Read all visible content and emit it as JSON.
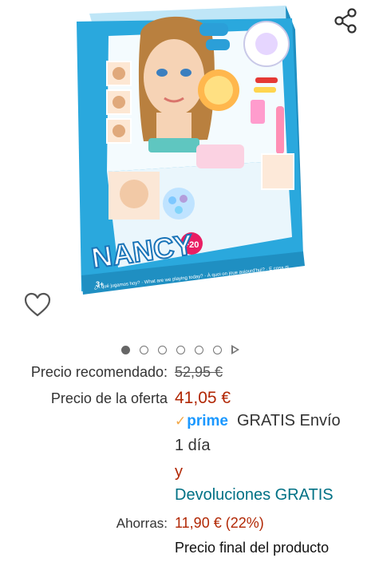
{
  "product": {
    "brand_on_box": "NANCY",
    "box_badge": "+20",
    "age_badge": "3+",
    "box_banner_text": "¿A qué jugamos hoy? · What are we playing today? · À quoi on joue aujourd'hui? · E cosa gi"
  },
  "actions": {
    "share_icon": "share-icon",
    "wishlist_icon": "heart-outline-icon"
  },
  "carousel": {
    "total_dots": 6,
    "active_index": 0,
    "has_video": true
  },
  "pricing": {
    "rrp_label": "Precio recomendado:",
    "rrp_value": "52,95 €",
    "offer_label": "Precio de la oferta",
    "offer_price": "41,05 €",
    "prime_label": "prime",
    "shipping_text": "GRATIS Envío",
    "delivery_days": "1 día",
    "and_text": "y",
    "returns_text": "Devoluciones GRATIS",
    "savings_label": "Ahorras:",
    "savings_value": "11,90 € (22%)",
    "final_price_note": "Precio final del producto"
  },
  "colors": {
    "price_red": "#B12704",
    "link_teal": "#007185",
    "prime_blue": "#1a98ff",
    "prime_check": "#f3a847",
    "box_blue": "#29a9dc"
  }
}
